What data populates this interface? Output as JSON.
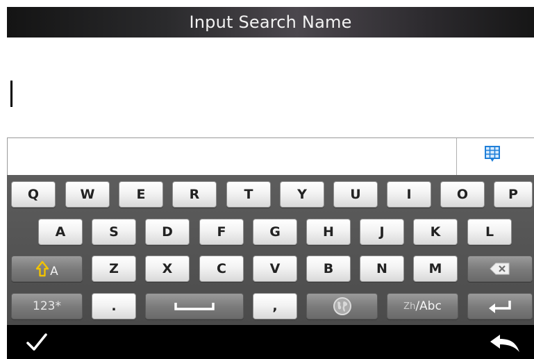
{
  "header": {
    "title": "Input Search Name"
  },
  "input": {
    "value": ""
  },
  "candidate_bar": {
    "icon": "grid-icon"
  },
  "keyboard": {
    "row1": [
      "Q",
      "W",
      "E",
      "R",
      "T",
      "Y",
      "U",
      "I",
      "O",
      "P"
    ],
    "row2": [
      "A",
      "S",
      "D",
      "F",
      "G",
      "H",
      "J",
      "K",
      "L"
    ],
    "row3": [
      "Z",
      "X",
      "C",
      "V",
      "B",
      "N",
      "M"
    ],
    "shift": {
      "icon": "shift-arrow-icon",
      "label": "A"
    },
    "backspace": {
      "icon": "backspace-icon"
    },
    "numbers_label": "123*",
    "period_label": ".",
    "space": {
      "icon": "space-icon"
    },
    "comma_label": ",",
    "globe": {
      "icon": "globe-icon"
    },
    "lang": {
      "prefix": "Zh",
      "suffix": "/Abc"
    },
    "enter": {
      "icon": "enter-icon"
    }
  },
  "footer": {
    "confirm_icon": "check-icon",
    "back_icon": "back-arrow-icon"
  },
  "colors": {
    "accent_yellow": "#f2c300",
    "grid_icon_blue": "#1f7fd8"
  }
}
